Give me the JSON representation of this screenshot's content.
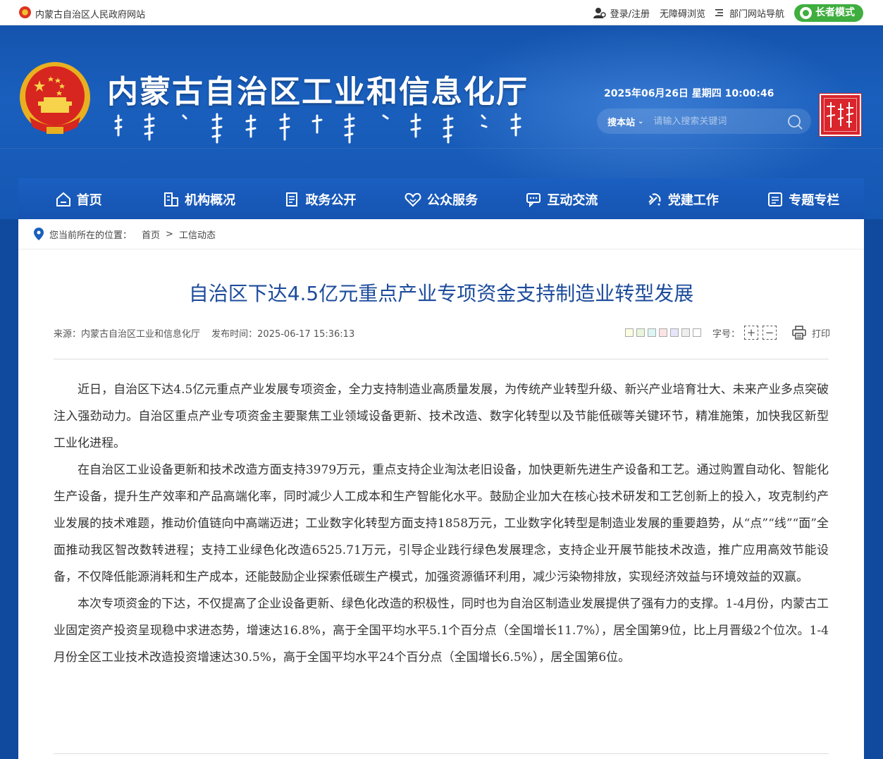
{
  "topbar": {
    "site_name": "内蒙古自治区人民政府网站",
    "login": "登录/注册",
    "accessible": "无障碍浏览",
    "dept_nav": "部门网站导航",
    "elder_mode": "长者模式"
  },
  "header": {
    "title": "内蒙古自治区工业和信息化厅",
    "datetime": "2025年06月26日 星期四 10:00:46",
    "search_scope": "搜本站",
    "search_placeholder": "请输入搜索关键词"
  },
  "nav": {
    "items": [
      {
        "label": "首页",
        "icon": "home-icon"
      },
      {
        "label": "机构概况",
        "icon": "building-icon"
      },
      {
        "label": "政务公开",
        "icon": "document-icon"
      },
      {
        "label": "公众服务",
        "icon": "heart-hand-icon"
      },
      {
        "label": "互动交流",
        "icon": "chat-icon"
      },
      {
        "label": "党建工作",
        "icon": "party-emblem-icon"
      },
      {
        "label": "专题专栏",
        "icon": "list-icon"
      }
    ]
  },
  "breadcrumb": {
    "prefix": "您当前所在的位置：",
    "home": "首页",
    "separator": ">",
    "current": "工信动态"
  },
  "article": {
    "title": "自治区下达4.5亿元重点产业专项资金支持制造业转型发展",
    "source": "来源：内蒙古自治区工业和信息化厅",
    "published": "发布时间：2025-06-17 15:36:13",
    "font_size_label": "字号：",
    "font_increase": "+",
    "font_decrease": "−",
    "print_label": "打印",
    "swatches": [
      "#fdfde0",
      "#e8f6dc",
      "#dcf6f4",
      "#fde4e4",
      "#e6e6fb",
      "#eeeeee",
      "#ffffff"
    ],
    "paragraphs": [
      "近日，自治区下达4.5亿元重点产业发展专项资金，全力支持制造业高质量发展，为传统产业转型升级、新兴产业培育壮大、未来产业多点突破注入强劲动力。自治区重点产业专项资金主要聚焦工业领域设备更新、技术改造、数字化转型以及节能低碳等关键环节，精准施策，加快我区新型工业化进程。",
      "在自治区工业设备更新和技术改造方面支持3979万元，重点支持企业淘汰老旧设备，加快更新先进生产设备和工艺。通过购置自动化、智能化生产设备，提升生产效率和产品高端化率，同时减少人工成本和生产智能化水平。鼓励企业加大在核心技术研发和工艺创新上的投入，攻克制约产业发展的技术难题，推动价值链向中高端迈进；工业数字化转型方面支持1858万元，工业数字化转型是制造业发展的重要趋势，从“点”“线”“面”全面推动我区智改数转进程；支持工业绿色化改造6525.71万元，引导企业践行绿色发展理念，支持企业开展节能技术改造，推广应用高效节能设备，不仅降低能源消耗和生产成本，还能鼓励企业探索低碳生产模式，加强资源循环利用，减少污染物排放，实现经济效益与环境效益的双赢。",
      "本次专项资金的下达，不仅提高了企业设备更新、绿色化改造的积极性，同时也为自治区制造业发展提供了强有力的支撑。1-4月份，内蒙古工业固定资产投资呈现稳中求进态势，增速达16.8%，高于全国平均水平5.1个百分点（全国增长11.7%），居全国第9位，比上月晋级2个位次。1-4月份全区工业技术改造投资增速达30.5%，高于全国平均水平24个百分点（全国增长6.5%），居全国第6位。"
    ]
  }
}
